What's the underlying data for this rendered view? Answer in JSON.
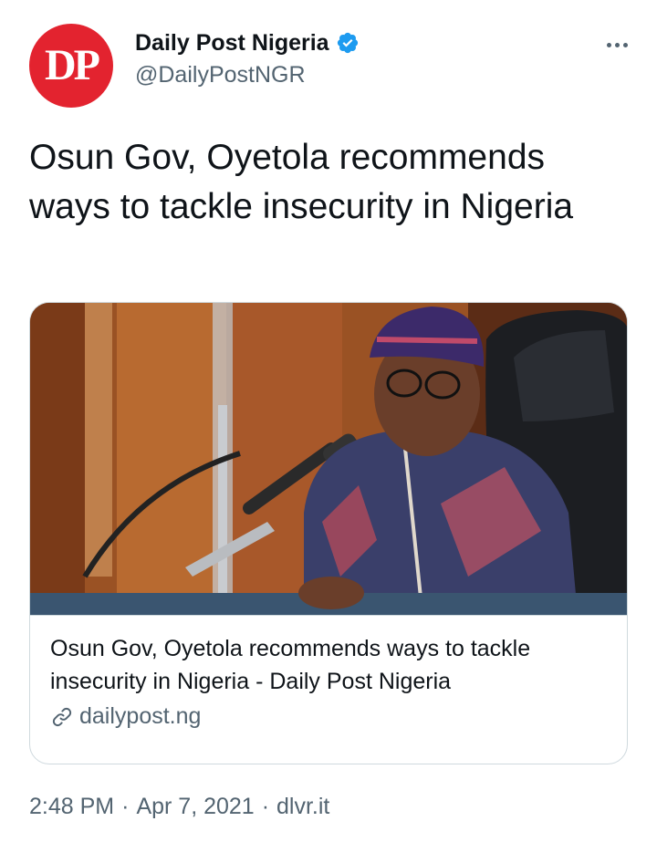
{
  "author": {
    "avatar_text": "DP",
    "display_name": "Daily Post Nigeria",
    "handle": "@DailyPostNGR",
    "verified": true
  },
  "tweet": {
    "text": "Osun Gov, Oyetola recommends ways to tackle insecurity in Nigeria"
  },
  "card": {
    "title": "Osun Gov, Oyetola recommends ways to tackle insecurity in Nigeria - Daily Post Nigeria",
    "domain": "dailypost.ng",
    "image_icon": "photo-of-speaker-at-microphone"
  },
  "meta": {
    "time": "2:48 PM",
    "date": "Apr 7, 2021",
    "separator": "·",
    "source": "dlvr.it"
  },
  "colors": {
    "avatar_bg": "#e3232f",
    "verified": "#1d9bf0",
    "text_primary": "#0f1419",
    "text_secondary": "#536471",
    "border": "#cfd9de"
  }
}
